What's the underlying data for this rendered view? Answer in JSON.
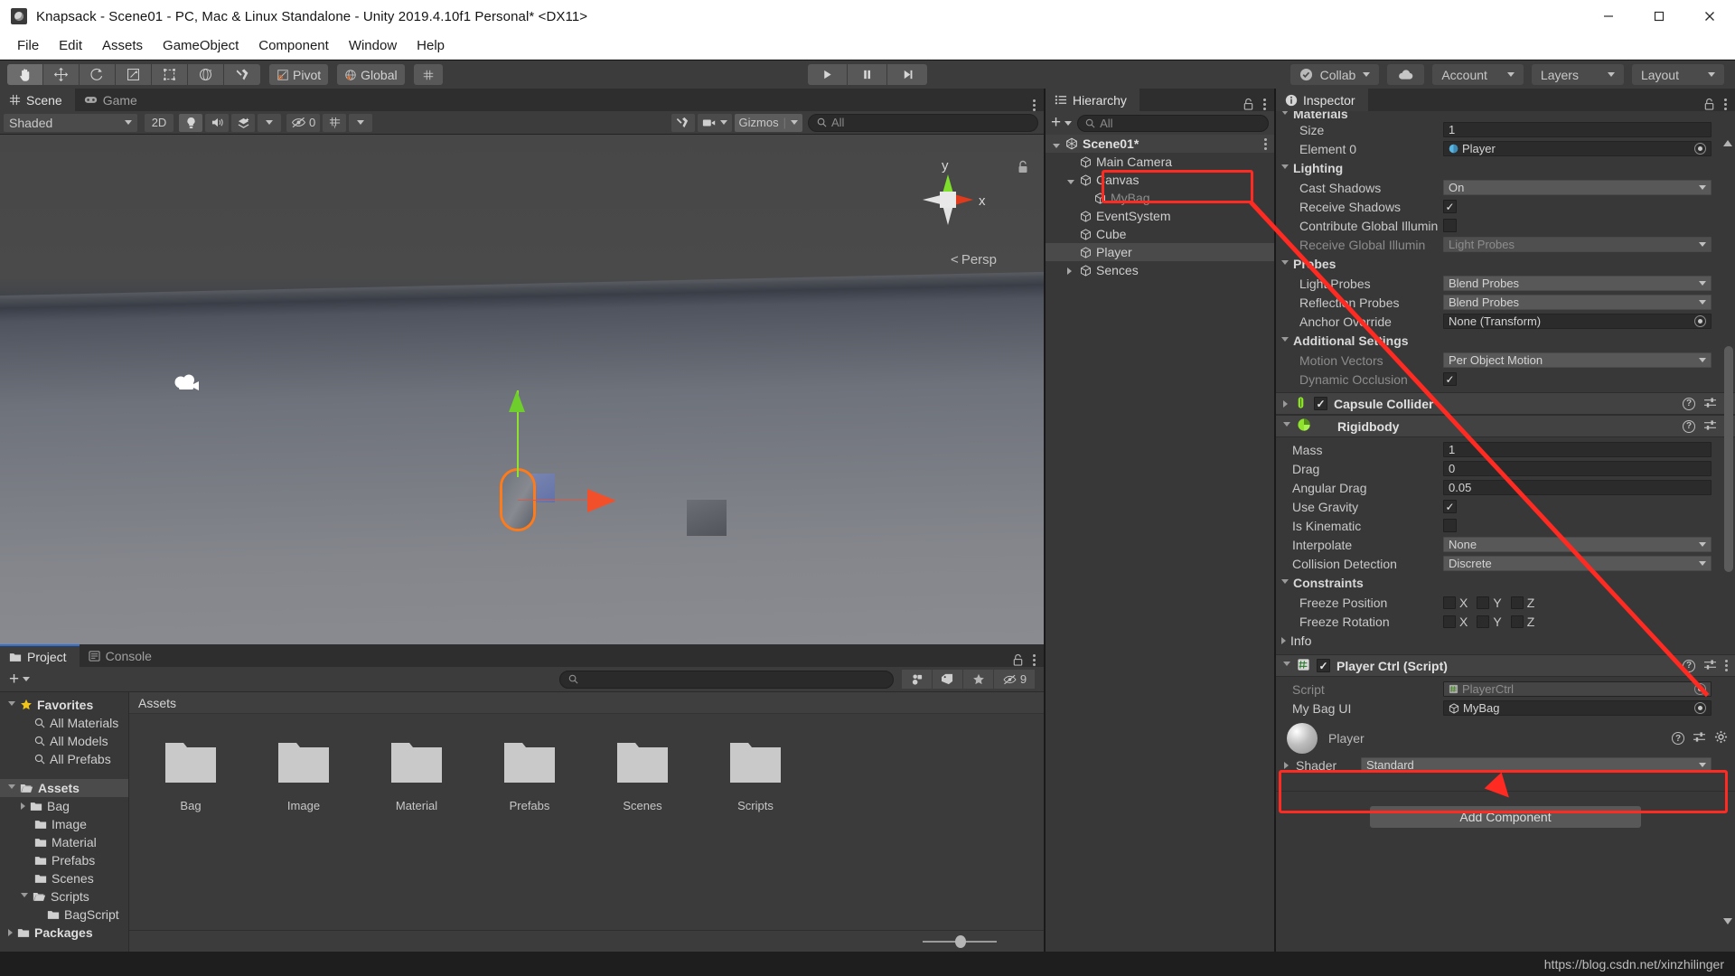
{
  "window": {
    "title": "Knapsack - Scene01 - PC, Mac & Linux Standalone - Unity 2019.4.10f1 Personal* <DX11>",
    "minimize": "–",
    "maximize": "□",
    "close": "✕"
  },
  "menubar": {
    "items": [
      "File",
      "Edit",
      "Assets",
      "GameObject",
      "Component",
      "Window",
      "Help"
    ]
  },
  "toolbar": {
    "transform_tools": [
      "hand-tool",
      "move-tool",
      "rotate-tool",
      "scale-tool",
      "rect-tool",
      "transform-tool",
      "custom-tool"
    ],
    "pivot_label": "Pivot",
    "handle_label": "Global",
    "grid_label": "grid-snap",
    "play": "play",
    "pause": "pause",
    "step": "step",
    "collab_label": "Collab",
    "cloud_label": "cloud",
    "account_label": "Account",
    "layers_label": "Layers",
    "layout_label": "Layout"
  },
  "scene": {
    "tabs": [
      {
        "label": "Scene",
        "icon": "grid-icon",
        "active": true
      },
      {
        "label": "Game",
        "icon": "gamepad-icon",
        "active": false
      }
    ],
    "draw_mode": "Shaded",
    "mode_2d": "2D",
    "lighting_toggle": "light-bulb-icon",
    "audio_toggle": "audio-icon",
    "fx_toggle": "fx-icon",
    "hidden_count": "0",
    "grid_toggle": "grid-visibility-icon",
    "tools_icon": "scene-tools-icon",
    "camera_icon": "scene-camera-icon",
    "gizmos_label": "Gizmos",
    "search_placeholder": "All",
    "axis_x": "x",
    "axis_y": "y",
    "persp_label": "Persp",
    "lock_icon": "lock-icon"
  },
  "hierarchy": {
    "tab_label": "Hierarchy",
    "create_label": "+",
    "search_placeholder": "All",
    "items": [
      {
        "label": "Scene01*",
        "depth": 0,
        "arrow": "open",
        "icon": "unity-scene-icon",
        "state": "scene"
      },
      {
        "label": "Main Camera",
        "depth": 1,
        "arrow": "none",
        "icon": "gameobject-icon",
        "state": "normal"
      },
      {
        "label": "Canvas",
        "depth": 1,
        "arrow": "open",
        "icon": "gameobject-icon",
        "state": "normal"
      },
      {
        "label": "MyBag",
        "depth": 2,
        "arrow": "none",
        "icon": "gameobject-icon",
        "state": "dim"
      },
      {
        "label": "EventSystem",
        "depth": 1,
        "arrow": "none",
        "icon": "gameobject-icon",
        "state": "normal"
      },
      {
        "label": "Cube",
        "depth": 1,
        "arrow": "none",
        "icon": "gameobject-icon",
        "state": "normal"
      },
      {
        "label": "Player",
        "depth": 1,
        "arrow": "none",
        "icon": "gameobject-icon",
        "state": "selected"
      },
      {
        "label": "Sences",
        "depth": 1,
        "arrow": "closed",
        "icon": "gameobject-icon",
        "state": "normal"
      }
    ]
  },
  "inspector": {
    "tab_label": "Inspector",
    "materials": {
      "title": "Materials",
      "size_label": "Size",
      "size_value": "1",
      "element_label": "Element 0",
      "element_value": "Player"
    },
    "lighting": {
      "title": "Lighting",
      "cast_shadows_label": "Cast Shadows",
      "cast_shadows_value": "On",
      "receive_shadows_label": "Receive Shadows",
      "receive_shadows_checked": true,
      "contribute_gi_label": "Contribute Global Illumin",
      "contribute_gi_checked": false,
      "receive_gi_label": "Receive Global Illumin",
      "receive_gi_value": "Light Probes"
    },
    "probes": {
      "title": "Probes",
      "light_probes_label": "Light Probes",
      "light_probes_value": "Blend Probes",
      "reflection_probes_label": "Reflection Probes",
      "reflection_probes_value": "Blend Probes",
      "anchor_override_label": "Anchor Override",
      "anchor_override_value": "None (Transform)"
    },
    "additional": {
      "title": "Additional Settings",
      "motion_vectors_label": "Motion Vectors",
      "motion_vectors_value": "Per Object Motion",
      "dynamic_occlusion_label": "Dynamic Occlusion",
      "dynamic_occlusion_checked": true
    },
    "capsule_collider": {
      "title": "Capsule Collider",
      "enabled": true
    },
    "rigidbody": {
      "title": "Rigidbody",
      "mass_label": "Mass",
      "mass_value": "1",
      "drag_label": "Drag",
      "drag_value": "0",
      "angular_drag_label": "Angular Drag",
      "angular_drag_value": "0.05",
      "use_gravity_label": "Use Gravity",
      "use_gravity_checked": true,
      "is_kinematic_label": "Is Kinematic",
      "is_kinematic_checked": false,
      "interpolate_label": "Interpolate",
      "interpolate_value": "None",
      "collision_detection_label": "Collision Detection",
      "collision_detection_value": "Discrete",
      "constraints_title": "Constraints",
      "freeze_position_label": "Freeze Position",
      "freeze_rotation_label": "Freeze Rotation",
      "axes": [
        "X",
        "Y",
        "Z"
      ],
      "info_title": "Info"
    },
    "player_ctrl": {
      "title": "Player Ctrl (Script)",
      "enabled": true,
      "script_label": "Script",
      "script_value": "PlayerCtrl",
      "mybag_label": "My Bag UI",
      "mybag_value": "MyBag"
    },
    "material": {
      "name": "Player",
      "shader_label": "Shader",
      "shader_value": "Standard"
    },
    "add_component_label": "Add Component"
  },
  "project": {
    "tabs": [
      {
        "label": "Project",
        "icon": "folder-icon",
        "active": true
      },
      {
        "label": "Console",
        "icon": "console-icon",
        "active": false
      }
    ],
    "create_label": "+",
    "search_placeholder": "",
    "icon_buttons": [
      "object-filter-icon",
      "label-filter-icon",
      "favorite-icon"
    ],
    "hidden_count": "9",
    "tree": [
      {
        "label": "Favorites",
        "depth": 0,
        "arrow": "open",
        "icon": "star-icon",
        "bold": true,
        "selected": false
      },
      {
        "label": "All Materials",
        "depth": 1,
        "arrow": "none",
        "icon": "search-icon",
        "bold": false,
        "selected": false
      },
      {
        "label": "All Models",
        "depth": 1,
        "arrow": "none",
        "icon": "search-icon",
        "bold": false,
        "selected": false
      },
      {
        "label": "All Prefabs",
        "depth": 1,
        "arrow": "none",
        "icon": "search-icon",
        "bold": false,
        "selected": false
      },
      {
        "label": "",
        "depth": 0,
        "arrow": "none",
        "icon": "spacer",
        "bold": false,
        "selected": false
      },
      {
        "label": "Assets",
        "depth": 0,
        "arrow": "open",
        "icon": "folder-open-icon",
        "bold": true,
        "selected": true
      },
      {
        "label": "Bag",
        "depth": 1,
        "arrow": "closed",
        "icon": "folder-icon",
        "bold": false,
        "selected": false
      },
      {
        "label": "Image",
        "depth": 1,
        "arrow": "none",
        "icon": "folder-icon",
        "bold": false,
        "selected": false
      },
      {
        "label": "Material",
        "depth": 1,
        "arrow": "none",
        "icon": "folder-icon",
        "bold": false,
        "selected": false
      },
      {
        "label": "Prefabs",
        "depth": 1,
        "arrow": "none",
        "icon": "folder-icon",
        "bold": false,
        "selected": false
      },
      {
        "label": "Scenes",
        "depth": 1,
        "arrow": "none",
        "icon": "folder-icon",
        "bold": false,
        "selected": false
      },
      {
        "label": "Scripts",
        "depth": 1,
        "arrow": "open",
        "icon": "folder-open-icon",
        "bold": false,
        "selected": false
      },
      {
        "label": "BagScript",
        "depth": 2,
        "arrow": "none",
        "icon": "folder-icon",
        "bold": false,
        "selected": false
      },
      {
        "label": "Packages",
        "depth": 0,
        "arrow": "closed",
        "icon": "folder-icon",
        "bold": true,
        "selected": false
      }
    ],
    "breadcrumb": "Assets",
    "folders": [
      "Bag",
      "Image",
      "Material",
      "Prefabs",
      "Scenes",
      "Scripts"
    ]
  },
  "annotations": {
    "mybag_hierarchy_box": "highlight-mybag-hierarchy",
    "mybag_inspector_box": "highlight-mybag-inspector",
    "arrow": "arrow-hierarchy-to-inspector"
  },
  "footer": {
    "watermark": "https://blog.csdn.net/xinzhilinger"
  },
  "colors": {
    "accent_red": "#ff2a21",
    "unity_bg": "#383838",
    "panel_header": "#3c3c3c",
    "selection": "#4a4a4a",
    "axis_green": "#8fe32d",
    "axis_red": "#f2502a",
    "selection_outline": "#ff7a18"
  }
}
